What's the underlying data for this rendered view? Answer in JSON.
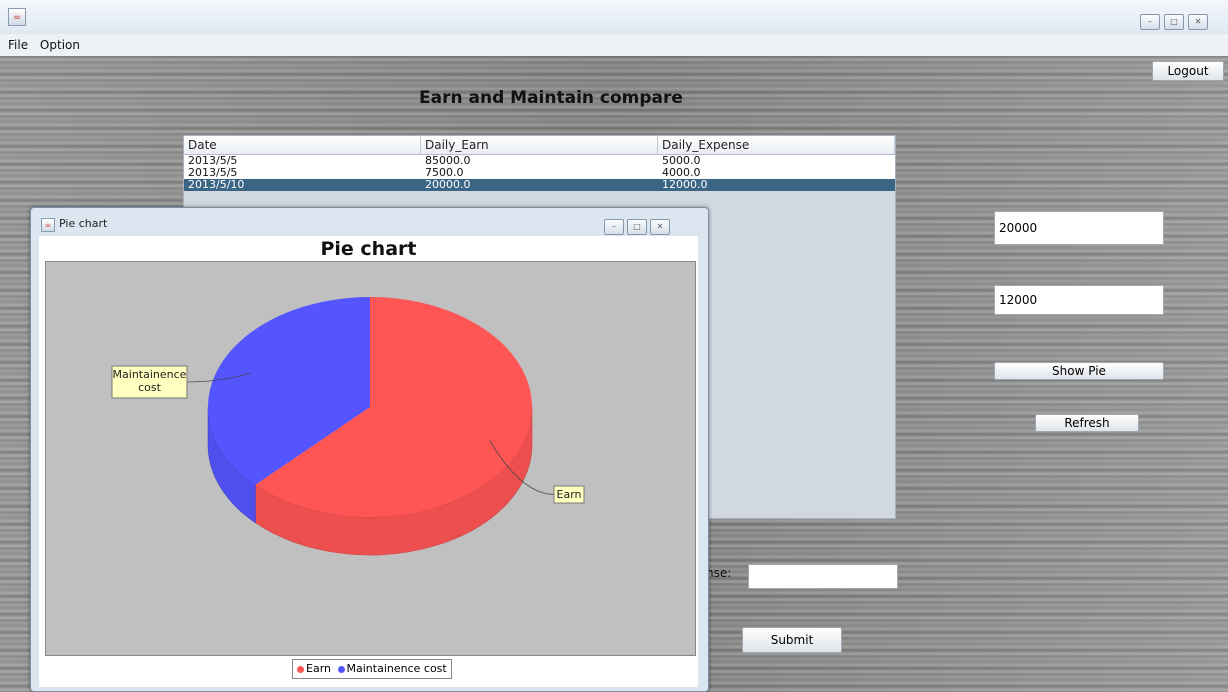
{
  "menubar": {
    "items": [
      "File",
      "Option"
    ]
  },
  "main": {
    "title": "Earn and Maintain compare",
    "logout_label": "Logout",
    "table": {
      "headers": [
        "Date",
        "Daily_Earn",
        "Daily_Expense"
      ],
      "rows": [
        [
          "2013/5/5",
          "85000.0",
          "5000.0"
        ],
        [
          "2013/5/5",
          "7500.0",
          "4000.0"
        ],
        [
          "2013/5/10",
          "20000.0",
          "12000.0"
        ]
      ],
      "selected_row": 2
    },
    "earn_field_value": "20000",
    "expense_field_value": "12000",
    "show_pie_label": "Show Pie",
    "refresh_label": "Refresh",
    "expense_label_fragment": "nse:",
    "expense_input_value": "",
    "submit_label": "Submit"
  },
  "pie_window": {
    "title": "Pie chart"
  },
  "colors": {
    "earn": "#ff5555",
    "maintainence": "#5555ff",
    "plot_bg": "#c0c0c0",
    "selection": "#3b6585"
  },
  "chart_data": {
    "type": "pie",
    "title": "Pie chart",
    "categories": [
      "Earn",
      "Maintainence cost"
    ],
    "values": [
      20000,
      12000
    ],
    "labels": [
      "Earn",
      "Maintainence\ncost"
    ],
    "legend": {
      "placement": "bottom",
      "entries": [
        "Earn",
        "Maintainence cost"
      ]
    }
  }
}
